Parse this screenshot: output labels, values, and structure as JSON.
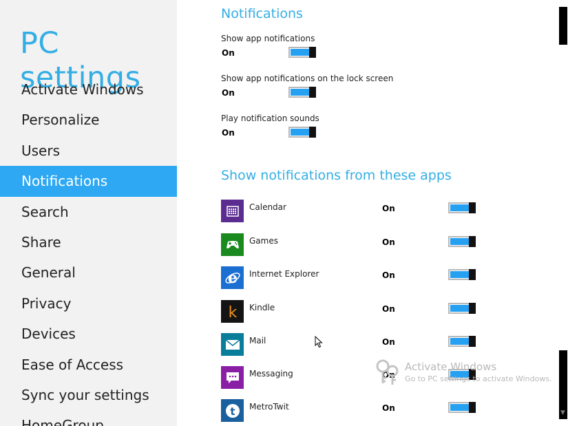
{
  "sidebar": {
    "title": "PC settings",
    "items": [
      {
        "label": "Activate Windows",
        "active": false
      },
      {
        "label": "Personalize",
        "active": false
      },
      {
        "label": "Users",
        "active": false
      },
      {
        "label": "Notifications",
        "active": true
      },
      {
        "label": "Search",
        "active": false
      },
      {
        "label": "Share",
        "active": false
      },
      {
        "label": "General",
        "active": false
      },
      {
        "label": "Privacy",
        "active": false
      },
      {
        "label": "Devices",
        "active": false
      },
      {
        "label": "Ease of Access",
        "active": false
      },
      {
        "label": "Sync your settings",
        "active": false
      },
      {
        "label": "HomeGroup",
        "active": false
      }
    ]
  },
  "main": {
    "section_title": "Notifications",
    "settings": [
      {
        "label": "Show app notifications",
        "state": "On"
      },
      {
        "label": "Show app notifications on the lock screen",
        "state": "On"
      },
      {
        "label": "Play notification sounds",
        "state": "On"
      }
    ],
    "apps_title": "Show notifications from these apps",
    "apps": [
      {
        "name": "Calendar",
        "state": "On",
        "icon": "calendar-icon",
        "color": "#5b2d90"
      },
      {
        "name": "Games",
        "state": "On",
        "icon": "gamepad-icon",
        "color": "#1a8a1f"
      },
      {
        "name": "Internet Explorer",
        "state": "On",
        "icon": "internet-explorer-icon",
        "color": "#1a6fd1"
      },
      {
        "name": "Kindle",
        "state": "On",
        "icon": "kindle-icon",
        "color": "#141414"
      },
      {
        "name": "Mail",
        "state": "On",
        "icon": "mail-icon",
        "color": "#0a7d9a"
      },
      {
        "name": "Messaging",
        "state": "On",
        "icon": "messaging-icon",
        "color": "#8a1fa6"
      },
      {
        "name": "MetroTwit",
        "state": "On",
        "icon": "metrotwit-icon",
        "color": "#1a5f9e"
      }
    ]
  },
  "watermark": {
    "title": "Activate Windows",
    "subtitle": "Go to PC settings to activate Windows."
  },
  "colors": {
    "accent": "#33aee5",
    "selected": "#2ea8f2",
    "toggle_on": "#26a0f0"
  }
}
